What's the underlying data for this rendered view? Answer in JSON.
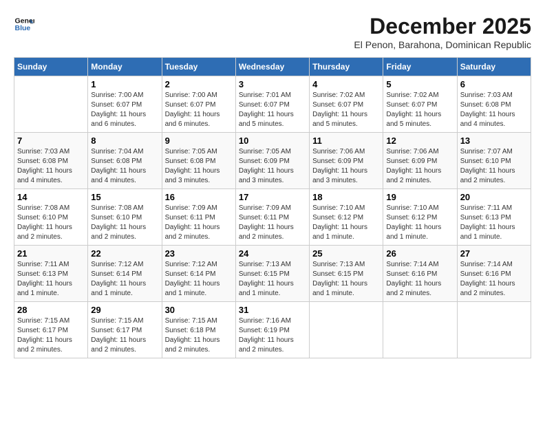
{
  "header": {
    "logo_line1": "General",
    "logo_line2": "Blue",
    "month_year": "December 2025",
    "location": "El Penon, Barahona, Dominican Republic"
  },
  "days_of_week": [
    "Sunday",
    "Monday",
    "Tuesday",
    "Wednesday",
    "Thursday",
    "Friday",
    "Saturday"
  ],
  "weeks": [
    [
      {
        "day": "",
        "sunrise": "",
        "sunset": "",
        "daylight": ""
      },
      {
        "day": "1",
        "sunrise": "Sunrise: 7:00 AM",
        "sunset": "Sunset: 6:07 PM",
        "daylight": "Daylight: 11 hours and 6 minutes."
      },
      {
        "day": "2",
        "sunrise": "Sunrise: 7:00 AM",
        "sunset": "Sunset: 6:07 PM",
        "daylight": "Daylight: 11 hours and 6 minutes."
      },
      {
        "day": "3",
        "sunrise": "Sunrise: 7:01 AM",
        "sunset": "Sunset: 6:07 PM",
        "daylight": "Daylight: 11 hours and 5 minutes."
      },
      {
        "day": "4",
        "sunrise": "Sunrise: 7:02 AM",
        "sunset": "Sunset: 6:07 PM",
        "daylight": "Daylight: 11 hours and 5 minutes."
      },
      {
        "day": "5",
        "sunrise": "Sunrise: 7:02 AM",
        "sunset": "Sunset: 6:07 PM",
        "daylight": "Daylight: 11 hours and 5 minutes."
      },
      {
        "day": "6",
        "sunrise": "Sunrise: 7:03 AM",
        "sunset": "Sunset: 6:08 PM",
        "daylight": "Daylight: 11 hours and 4 minutes."
      }
    ],
    [
      {
        "day": "7",
        "sunrise": "Sunrise: 7:03 AM",
        "sunset": "Sunset: 6:08 PM",
        "daylight": "Daylight: 11 hours and 4 minutes."
      },
      {
        "day": "8",
        "sunrise": "Sunrise: 7:04 AM",
        "sunset": "Sunset: 6:08 PM",
        "daylight": "Daylight: 11 hours and 4 minutes."
      },
      {
        "day": "9",
        "sunrise": "Sunrise: 7:05 AM",
        "sunset": "Sunset: 6:08 PM",
        "daylight": "Daylight: 11 hours and 3 minutes."
      },
      {
        "day": "10",
        "sunrise": "Sunrise: 7:05 AM",
        "sunset": "Sunset: 6:09 PM",
        "daylight": "Daylight: 11 hours and 3 minutes."
      },
      {
        "day": "11",
        "sunrise": "Sunrise: 7:06 AM",
        "sunset": "Sunset: 6:09 PM",
        "daylight": "Daylight: 11 hours and 3 minutes."
      },
      {
        "day": "12",
        "sunrise": "Sunrise: 7:06 AM",
        "sunset": "Sunset: 6:09 PM",
        "daylight": "Daylight: 11 hours and 2 minutes."
      },
      {
        "day": "13",
        "sunrise": "Sunrise: 7:07 AM",
        "sunset": "Sunset: 6:10 PM",
        "daylight": "Daylight: 11 hours and 2 minutes."
      }
    ],
    [
      {
        "day": "14",
        "sunrise": "Sunrise: 7:08 AM",
        "sunset": "Sunset: 6:10 PM",
        "daylight": "Daylight: 11 hours and 2 minutes."
      },
      {
        "day": "15",
        "sunrise": "Sunrise: 7:08 AM",
        "sunset": "Sunset: 6:10 PM",
        "daylight": "Daylight: 11 hours and 2 minutes."
      },
      {
        "day": "16",
        "sunrise": "Sunrise: 7:09 AM",
        "sunset": "Sunset: 6:11 PM",
        "daylight": "Daylight: 11 hours and 2 minutes."
      },
      {
        "day": "17",
        "sunrise": "Sunrise: 7:09 AM",
        "sunset": "Sunset: 6:11 PM",
        "daylight": "Daylight: 11 hours and 2 minutes."
      },
      {
        "day": "18",
        "sunrise": "Sunrise: 7:10 AM",
        "sunset": "Sunset: 6:12 PM",
        "daylight": "Daylight: 11 hours and 1 minute."
      },
      {
        "day": "19",
        "sunrise": "Sunrise: 7:10 AM",
        "sunset": "Sunset: 6:12 PM",
        "daylight": "Daylight: 11 hours and 1 minute."
      },
      {
        "day": "20",
        "sunrise": "Sunrise: 7:11 AM",
        "sunset": "Sunset: 6:13 PM",
        "daylight": "Daylight: 11 hours and 1 minute."
      }
    ],
    [
      {
        "day": "21",
        "sunrise": "Sunrise: 7:11 AM",
        "sunset": "Sunset: 6:13 PM",
        "daylight": "Daylight: 11 hours and 1 minute."
      },
      {
        "day": "22",
        "sunrise": "Sunrise: 7:12 AM",
        "sunset": "Sunset: 6:14 PM",
        "daylight": "Daylight: 11 hours and 1 minute."
      },
      {
        "day": "23",
        "sunrise": "Sunrise: 7:12 AM",
        "sunset": "Sunset: 6:14 PM",
        "daylight": "Daylight: 11 hours and 1 minute."
      },
      {
        "day": "24",
        "sunrise": "Sunrise: 7:13 AM",
        "sunset": "Sunset: 6:15 PM",
        "daylight": "Daylight: 11 hours and 1 minute."
      },
      {
        "day": "25",
        "sunrise": "Sunrise: 7:13 AM",
        "sunset": "Sunset: 6:15 PM",
        "daylight": "Daylight: 11 hours and 1 minute."
      },
      {
        "day": "26",
        "sunrise": "Sunrise: 7:14 AM",
        "sunset": "Sunset: 6:16 PM",
        "daylight": "Daylight: 11 hours and 2 minutes."
      },
      {
        "day": "27",
        "sunrise": "Sunrise: 7:14 AM",
        "sunset": "Sunset: 6:16 PM",
        "daylight": "Daylight: 11 hours and 2 minutes."
      }
    ],
    [
      {
        "day": "28",
        "sunrise": "Sunrise: 7:15 AM",
        "sunset": "Sunset: 6:17 PM",
        "daylight": "Daylight: 11 hours and 2 minutes."
      },
      {
        "day": "29",
        "sunrise": "Sunrise: 7:15 AM",
        "sunset": "Sunset: 6:17 PM",
        "daylight": "Daylight: 11 hours and 2 minutes."
      },
      {
        "day": "30",
        "sunrise": "Sunrise: 7:15 AM",
        "sunset": "Sunset: 6:18 PM",
        "daylight": "Daylight: 11 hours and 2 minutes."
      },
      {
        "day": "31",
        "sunrise": "Sunrise: 7:16 AM",
        "sunset": "Sunset: 6:19 PM",
        "daylight": "Daylight: 11 hours and 2 minutes."
      },
      {
        "day": "",
        "sunrise": "",
        "sunset": "",
        "daylight": ""
      },
      {
        "day": "",
        "sunrise": "",
        "sunset": "",
        "daylight": ""
      },
      {
        "day": "",
        "sunrise": "",
        "sunset": "",
        "daylight": ""
      }
    ]
  ]
}
